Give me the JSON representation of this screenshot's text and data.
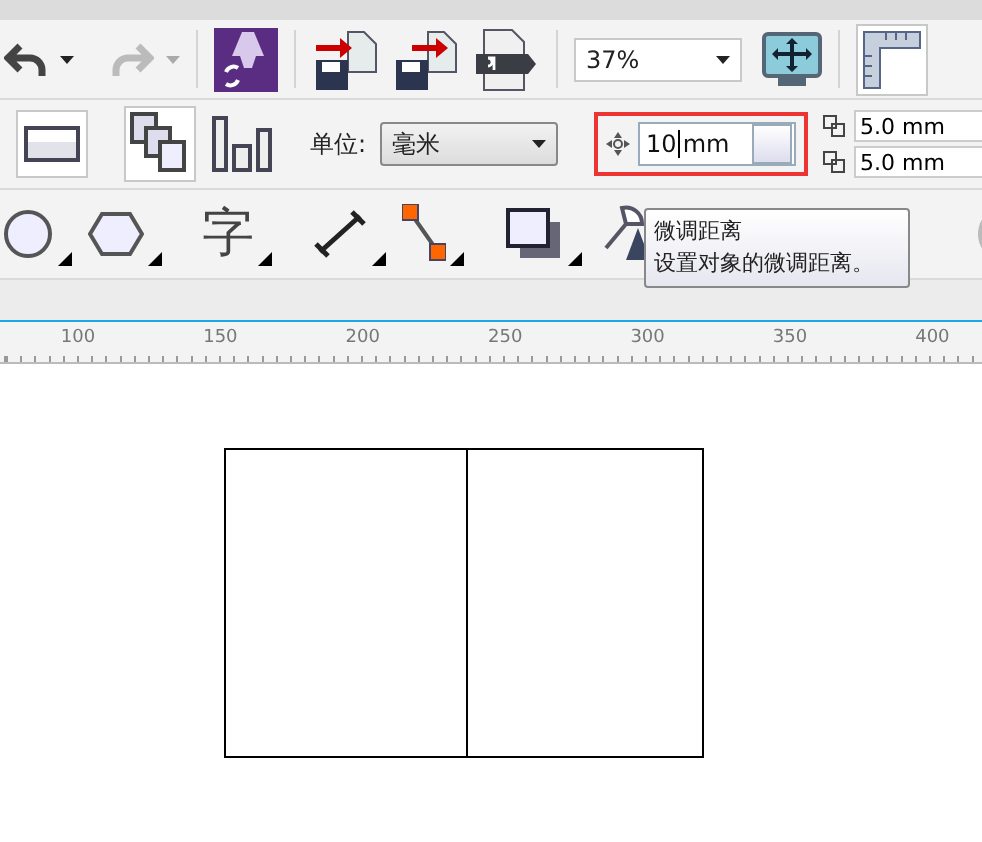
{
  "standard_toolbar": {
    "zoom": "37%"
  },
  "property_bar": {
    "units_label": "单位:",
    "units_value": "毫米",
    "nudge": {
      "value": "10",
      "unit": "mm",
      "highlighted": true
    },
    "duplicate_x": "5.0 mm",
    "duplicate_y": "5.0 mm"
  },
  "toolbox": {
    "text_tool": "字"
  },
  "tooltip": {
    "title": "微调距离",
    "text": "设置对象的微调距离。"
  },
  "ruler": {
    "labels": [
      "100",
      "150",
      "200",
      "250",
      "300",
      "350",
      "400"
    ]
  }
}
